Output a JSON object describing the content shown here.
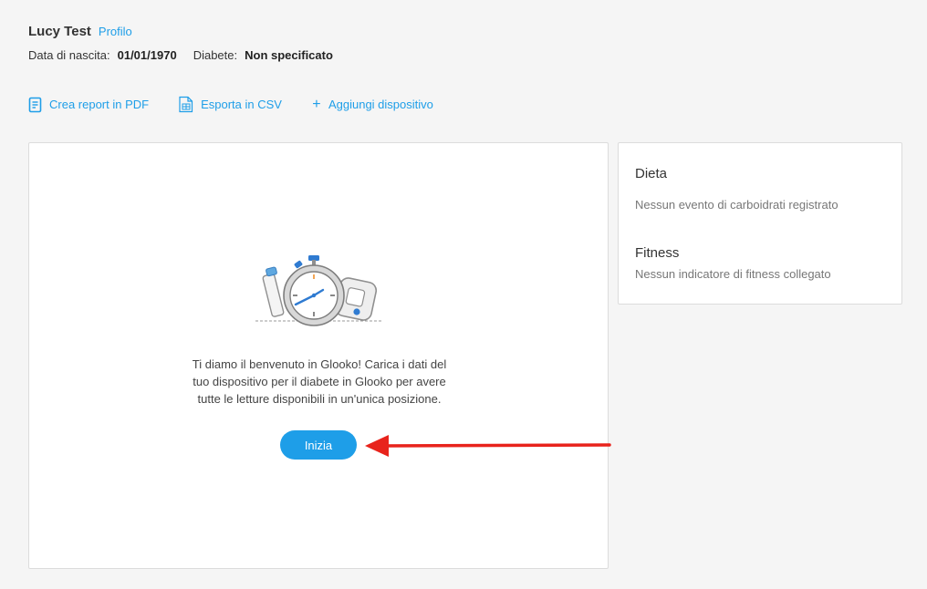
{
  "patient": {
    "name": "Lucy Test",
    "profile_link": "Profilo",
    "birth_label": "Data di nascita:",
    "birth_value": "01/01/1970",
    "diabetes_label": "Diabete:",
    "diabetes_value": "Non specificato"
  },
  "actions": {
    "pdf": {
      "label": "Crea report in PDF",
      "icon": "document-icon"
    },
    "csv": {
      "label": "Esporta in CSV",
      "icon": "spreadsheet-icon"
    },
    "device": {
      "label": "Aggiungi dispositivo",
      "icon": "plus-icon",
      "glyph": "+"
    }
  },
  "welcome": {
    "line1": "Ti diamo il benvenuto in Glooko! Carica i dati del",
    "line2": "tuo dispositivo per il diabete in Glooko per avere",
    "line3": "tutte le letture disponibili in un'unica posizione.",
    "button_label": "Inizia",
    "illustration_icon": "stopwatch-device-illustration"
  },
  "side": {
    "diet_title": "Dieta",
    "diet_text": "Nessun evento di carboidrati registrato",
    "fitness_title": "Fitness",
    "fitness_text": "Nessun indicatore di fitness collegato"
  },
  "colors": {
    "accent": "#1e9ee8",
    "annotation_arrow": "#e8231c",
    "background": "#f5f5f5",
    "card": "#ffffff"
  }
}
